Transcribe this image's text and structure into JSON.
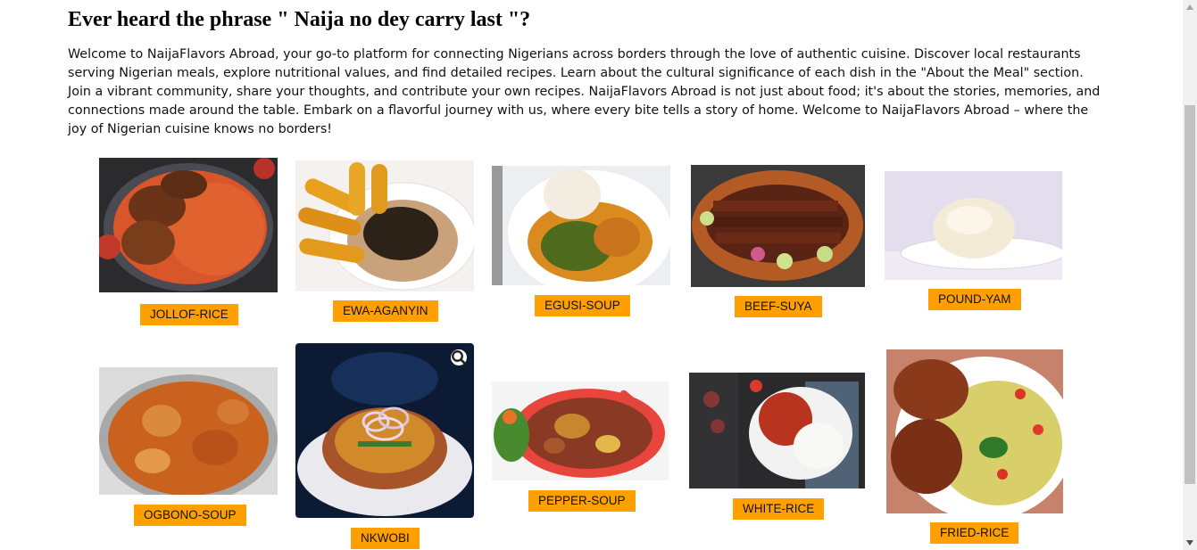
{
  "heading": "Ever heard the phrase \" Naija no dey carry last \"?",
  "intro": "Welcome to NaijaFlavors Abroad, your go-to platform for connecting Nigerians across borders through the love of authentic cuisine. Discover local restaurants serving Nigerian meals, explore nutritional values, and find detailed recipes. Learn about the cultural significance of each dish in the \"About the Meal\" section. Join a vibrant community, share your thoughts, and contribute your own recipes. NaijaFlavors Abroad is not just about food; it's about the stories, memories, and connections made around the table. Embark on a flavorful journey with us, where every bite tells a story of home. Welcome to NaijaFlavors Abroad – where the joy of Nigerian cuisine knows no borders!",
  "dishes": [
    {
      "label": "JOLLOF-RICE",
      "image": "jollof-rice-photo"
    },
    {
      "label": "EWA-AGANYIN",
      "image": "ewa-aganyin-photo"
    },
    {
      "label": "EGUSI-SOUP",
      "image": "egusi-soup-photo"
    },
    {
      "label": "BEEF-SUYA",
      "image": "beef-suya-photo"
    },
    {
      "label": "POUND-YAM",
      "image": "pound-yam-photo"
    },
    {
      "label": "OGBONO-SOUP",
      "image": "ogbono-soup-photo"
    },
    {
      "label": "NKWOBI",
      "image": "nkwobi-photo"
    },
    {
      "label": "PEPPER-SOUP",
      "image": "pepper-soup-photo"
    },
    {
      "label": "WHITE-RICE",
      "image": "white-rice-photo"
    },
    {
      "label": "FRIED-RICE",
      "image": "fried-rice-photo"
    }
  ],
  "icons": {
    "zoom": "magnifier-icon",
    "scroll_up": "arrow-up-icon",
    "scroll_down": "arrow-down-icon"
  },
  "colors": {
    "button": "#ff9f00",
    "background": "#ffffff"
  }
}
